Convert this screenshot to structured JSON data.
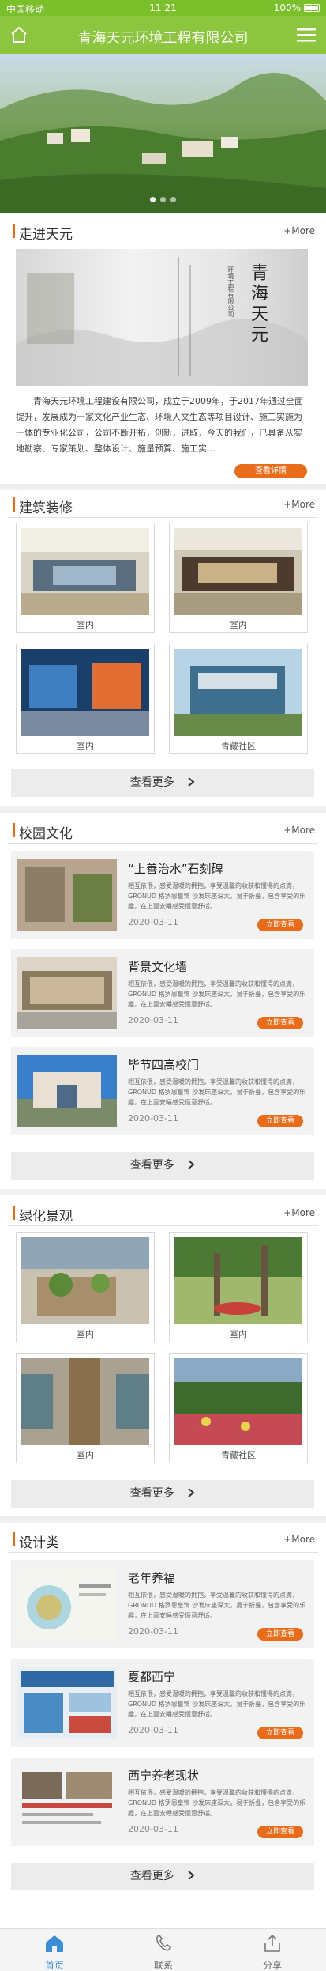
{
  "statusbar": {
    "carrier": "中国移动",
    "time": "11:21",
    "battery": "100%"
  },
  "header": {
    "title": "青海天元环境工程有限公司"
  },
  "banner": {
    "dots": 3,
    "active": 0
  },
  "about": {
    "title": "走进天元",
    "more": "+More",
    "calligraphy": "青海天元",
    "calligraphy_sub": "环境工程有限公司",
    "text": "青海天元环境工程建设有限公司，成立于2009年，于2017年通过全面提升，发展成为一家文化产业生态、环境人文生态等项目设计、施工实施为一体的专业化公司，公司不断开拓，创新，进取，今天的我们，已具备从实地勘察、专家策划、整体设计、施量预算、施工实…",
    "detail_button": "查看详情"
  },
  "architecture": {
    "title": "建筑装修",
    "more": "+More",
    "items": [
      {
        "caption": "室内"
      },
      {
        "caption": "室内"
      },
      {
        "caption": "室内"
      },
      {
        "caption": "青藏社区"
      }
    ],
    "view_more": "查看更多"
  },
  "campus": {
    "title": "校园文化",
    "more": "+More",
    "items": [
      {
        "title": "“上善治水”石刻碑",
        "desc": "相互依偎，感受温暖的拥抱，享受温馨的收获和懂得的点滴，GRONUD 格罗恩皇饰 沙发床座深大，易于折叠，包含享受的乐趣，在上面安睡感受惬意舒适。",
        "date": "2020-03-11",
        "button": "立即查看"
      },
      {
        "title": "背景文化墙",
        "desc": "相互依偎，感受温暖的拥抱，享受温馨的收获和懂得的点滴，GRONUD 格罗恩皇饰 沙发床座深大，易于折叠，包含享受的乐趣，在上面安睡感受惬意舒适。",
        "date": "2020-03-11",
        "button": "立即查看"
      },
      {
        "title": "毕节四高校门",
        "desc": "相互依偎，感受温暖的拥抱，享受温馨的收获和懂得的点滴，GRONUD 格罗恩皇饰 沙发床座深大，易于折叠，包含享受的乐趣，在上面安睡感受惬意舒适。",
        "date": "2020-03-11",
        "button": "立即查看"
      }
    ],
    "view_more": "查看更多"
  },
  "greenery": {
    "title": "绿化景观",
    "more": "+More",
    "items": [
      {
        "caption": "室内"
      },
      {
        "caption": "室内"
      },
      {
        "caption": "室内"
      },
      {
        "caption": "青藏社区"
      }
    ],
    "view_more": "查看更多"
  },
  "design": {
    "title": "设计类",
    "more": "+More",
    "items": [
      {
        "title": "老年养福",
        "desc": "相互依偎，感受温暖的拥抱，享受温馨的收获和懂得的点滴，GRONUD 格罗恩皇饰 沙发床座深大，易于折叠，包含享受的乐趣，在上面安睡感受惬意舒适。",
        "date": "2020-03-11",
        "button": "立即查看"
      },
      {
        "title": "夏都西宁",
        "desc": "相互依偎，感受温暖的拥抱，享受温馨的收获和懂得的点滴，GRONUD 格罗恩皇饰 沙发床座深大，易于折叠，包含享受的乐趣，在上面安睡感受惬意舒适。",
        "date": "2020-03-11",
        "button": "立即查看"
      },
      {
        "title": "西宁养老现状",
        "desc": "相互依偎，感受温暖的拥抱，享受温馨的收获和懂得的点滴，GRONUD 格罗恩皇饰 沙发床座深大，易于折叠，包含享受的乐趣，在上面安睡感受惬意舒适。",
        "date": "2020-03-11",
        "button": "立即查看"
      }
    ],
    "view_more": "查看更多"
  },
  "bottom_nav": [
    {
      "label": "首页",
      "icon": "home-icon",
      "active": true
    },
    {
      "label": "联系",
      "icon": "phone-icon",
      "active": false
    },
    {
      "label": "分享",
      "icon": "share-icon",
      "active": false
    }
  ],
  "colors": {
    "brand_green": "#8cc63f",
    "accent_orange": "#e86c1a",
    "nav_active_blue": "#3b8fd9"
  }
}
